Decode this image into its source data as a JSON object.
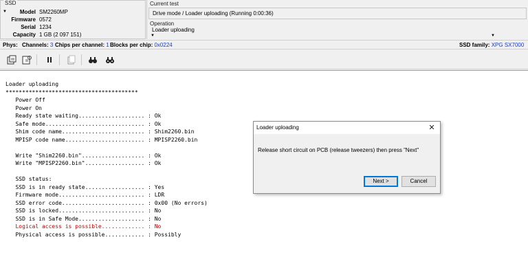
{
  "ssd": {
    "group_label": "SSD",
    "model_label": "Model",
    "model": "SM2260MP",
    "firmware_label": "Firmware",
    "firmware": "0572",
    "serial_label": "Serial",
    "serial": "1234",
    "capacity_label": "Capacity",
    "capacity": "1 GB (2 097 151)"
  },
  "current_test": {
    "label": "Current test",
    "value": "Drive mode / Loader uploading (Running 0:00:36)"
  },
  "operation": {
    "label": "Operation",
    "value": "Loader uploading"
  },
  "phys": {
    "phys_label": "Phys:",
    "channels_label": "Channels:",
    "channels": "3",
    "chips_label": "Chips per channel:",
    "chips": "1",
    "blocks_label": "Blocks per chip:",
    "blocks": "0x0224",
    "family_label": "SSD family:",
    "family": "XPG SX7000"
  },
  "toolbar": {
    "icons": [
      "save-icon",
      "refresh-icon",
      "pause-icon",
      "copy-icon",
      "find-icon",
      "find-next-icon"
    ]
  },
  "log": {
    "lines": [
      {
        "text": "Loader uploading",
        "red": false
      },
      {
        "text": "****************************************",
        "red": false
      },
      {
        "text": "   Power Off",
        "red": false
      },
      {
        "text": "   Power On",
        "red": false
      },
      {
        "text": "   Ready state waiting.................... : Ok",
        "red": false
      },
      {
        "text": "   Safe mode.............................. : Ok",
        "red": false
      },
      {
        "text": "   Shim code name......................... : Shim2260.bin",
        "red": false
      },
      {
        "text": "   MPISP code name........................ : MPISP2260.bin",
        "red": false
      },
      {
        "text": "",
        "red": false
      },
      {
        "text": "   Write \"Shim2260.bin\"................... : Ok",
        "red": false
      },
      {
        "text": "   Write \"MPISP2260.bin\".................. : Ok",
        "red": false
      },
      {
        "text": "",
        "red": false
      },
      {
        "text": "   SSD status:",
        "red": false
      },
      {
        "text": "   SSD is in ready state.................. : Yes",
        "red": false
      },
      {
        "text": "   Firmware mode.......................... : LDR",
        "red": false
      },
      {
        "text": "   SSD error code......................... : 0x00 (No errors)",
        "red": false
      },
      {
        "text": "   SSD is locked.......................... : No",
        "red": false
      },
      {
        "text": "   SSD is in Safe Mode.................... : No",
        "red": false
      },
      {
        "text": "   Logical access is possible............. : No",
        "red": true
      },
      {
        "text": "   Physical access is possible............ : Possibly",
        "red": false
      }
    ]
  },
  "dialog": {
    "title": "Loader uploading",
    "message": "Release short circuit on PCB (release tweezers) then press \"Next\"",
    "next_label": "Next >",
    "cancel_label": "Cancel"
  },
  "colors": {
    "accent_blue": "#1a3cc4",
    "error_red": "#c00000"
  }
}
